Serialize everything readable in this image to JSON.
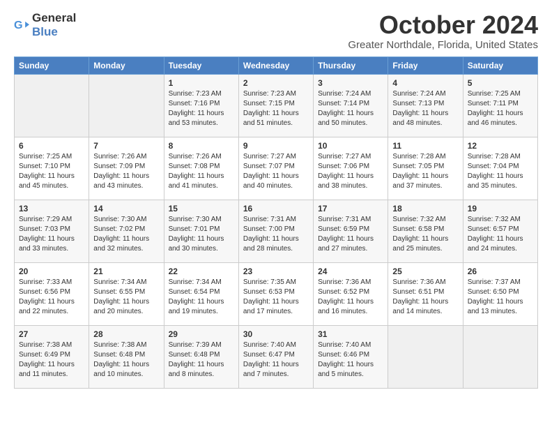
{
  "logo": {
    "text_general": "General",
    "text_blue": "Blue"
  },
  "title": {
    "month": "October 2024",
    "location": "Greater Northdale, Florida, United States"
  },
  "weekdays": [
    "Sunday",
    "Monday",
    "Tuesday",
    "Wednesday",
    "Thursday",
    "Friday",
    "Saturday"
  ],
  "weeks": [
    [
      {
        "day": "",
        "info": ""
      },
      {
        "day": "",
        "info": ""
      },
      {
        "day": "1",
        "info": "Sunrise: 7:23 AM\nSunset: 7:16 PM\nDaylight: 11 hours and 53 minutes."
      },
      {
        "day": "2",
        "info": "Sunrise: 7:23 AM\nSunset: 7:15 PM\nDaylight: 11 hours and 51 minutes."
      },
      {
        "day": "3",
        "info": "Sunrise: 7:24 AM\nSunset: 7:14 PM\nDaylight: 11 hours and 50 minutes."
      },
      {
        "day": "4",
        "info": "Sunrise: 7:24 AM\nSunset: 7:13 PM\nDaylight: 11 hours and 48 minutes."
      },
      {
        "day": "5",
        "info": "Sunrise: 7:25 AM\nSunset: 7:11 PM\nDaylight: 11 hours and 46 minutes."
      }
    ],
    [
      {
        "day": "6",
        "info": "Sunrise: 7:25 AM\nSunset: 7:10 PM\nDaylight: 11 hours and 45 minutes."
      },
      {
        "day": "7",
        "info": "Sunrise: 7:26 AM\nSunset: 7:09 PM\nDaylight: 11 hours and 43 minutes."
      },
      {
        "day": "8",
        "info": "Sunrise: 7:26 AM\nSunset: 7:08 PM\nDaylight: 11 hours and 41 minutes."
      },
      {
        "day": "9",
        "info": "Sunrise: 7:27 AM\nSunset: 7:07 PM\nDaylight: 11 hours and 40 minutes."
      },
      {
        "day": "10",
        "info": "Sunrise: 7:27 AM\nSunset: 7:06 PM\nDaylight: 11 hours and 38 minutes."
      },
      {
        "day": "11",
        "info": "Sunrise: 7:28 AM\nSunset: 7:05 PM\nDaylight: 11 hours and 37 minutes."
      },
      {
        "day": "12",
        "info": "Sunrise: 7:28 AM\nSunset: 7:04 PM\nDaylight: 11 hours and 35 minutes."
      }
    ],
    [
      {
        "day": "13",
        "info": "Sunrise: 7:29 AM\nSunset: 7:03 PM\nDaylight: 11 hours and 33 minutes."
      },
      {
        "day": "14",
        "info": "Sunrise: 7:30 AM\nSunset: 7:02 PM\nDaylight: 11 hours and 32 minutes."
      },
      {
        "day": "15",
        "info": "Sunrise: 7:30 AM\nSunset: 7:01 PM\nDaylight: 11 hours and 30 minutes."
      },
      {
        "day": "16",
        "info": "Sunrise: 7:31 AM\nSunset: 7:00 PM\nDaylight: 11 hours and 28 minutes."
      },
      {
        "day": "17",
        "info": "Sunrise: 7:31 AM\nSunset: 6:59 PM\nDaylight: 11 hours and 27 minutes."
      },
      {
        "day": "18",
        "info": "Sunrise: 7:32 AM\nSunset: 6:58 PM\nDaylight: 11 hours and 25 minutes."
      },
      {
        "day": "19",
        "info": "Sunrise: 7:32 AM\nSunset: 6:57 PM\nDaylight: 11 hours and 24 minutes."
      }
    ],
    [
      {
        "day": "20",
        "info": "Sunrise: 7:33 AM\nSunset: 6:56 PM\nDaylight: 11 hours and 22 minutes."
      },
      {
        "day": "21",
        "info": "Sunrise: 7:34 AM\nSunset: 6:55 PM\nDaylight: 11 hours and 20 minutes."
      },
      {
        "day": "22",
        "info": "Sunrise: 7:34 AM\nSunset: 6:54 PM\nDaylight: 11 hours and 19 minutes."
      },
      {
        "day": "23",
        "info": "Sunrise: 7:35 AM\nSunset: 6:53 PM\nDaylight: 11 hours and 17 minutes."
      },
      {
        "day": "24",
        "info": "Sunrise: 7:36 AM\nSunset: 6:52 PM\nDaylight: 11 hours and 16 minutes."
      },
      {
        "day": "25",
        "info": "Sunrise: 7:36 AM\nSunset: 6:51 PM\nDaylight: 11 hours and 14 minutes."
      },
      {
        "day": "26",
        "info": "Sunrise: 7:37 AM\nSunset: 6:50 PM\nDaylight: 11 hours and 13 minutes."
      }
    ],
    [
      {
        "day": "27",
        "info": "Sunrise: 7:38 AM\nSunset: 6:49 PM\nDaylight: 11 hours and 11 minutes."
      },
      {
        "day": "28",
        "info": "Sunrise: 7:38 AM\nSunset: 6:48 PM\nDaylight: 11 hours and 10 minutes."
      },
      {
        "day": "29",
        "info": "Sunrise: 7:39 AM\nSunset: 6:48 PM\nDaylight: 11 hours and 8 minutes."
      },
      {
        "day": "30",
        "info": "Sunrise: 7:40 AM\nSunset: 6:47 PM\nDaylight: 11 hours and 7 minutes."
      },
      {
        "day": "31",
        "info": "Sunrise: 7:40 AM\nSunset: 6:46 PM\nDaylight: 11 hours and 5 minutes."
      },
      {
        "day": "",
        "info": ""
      },
      {
        "day": "",
        "info": ""
      }
    ]
  ]
}
